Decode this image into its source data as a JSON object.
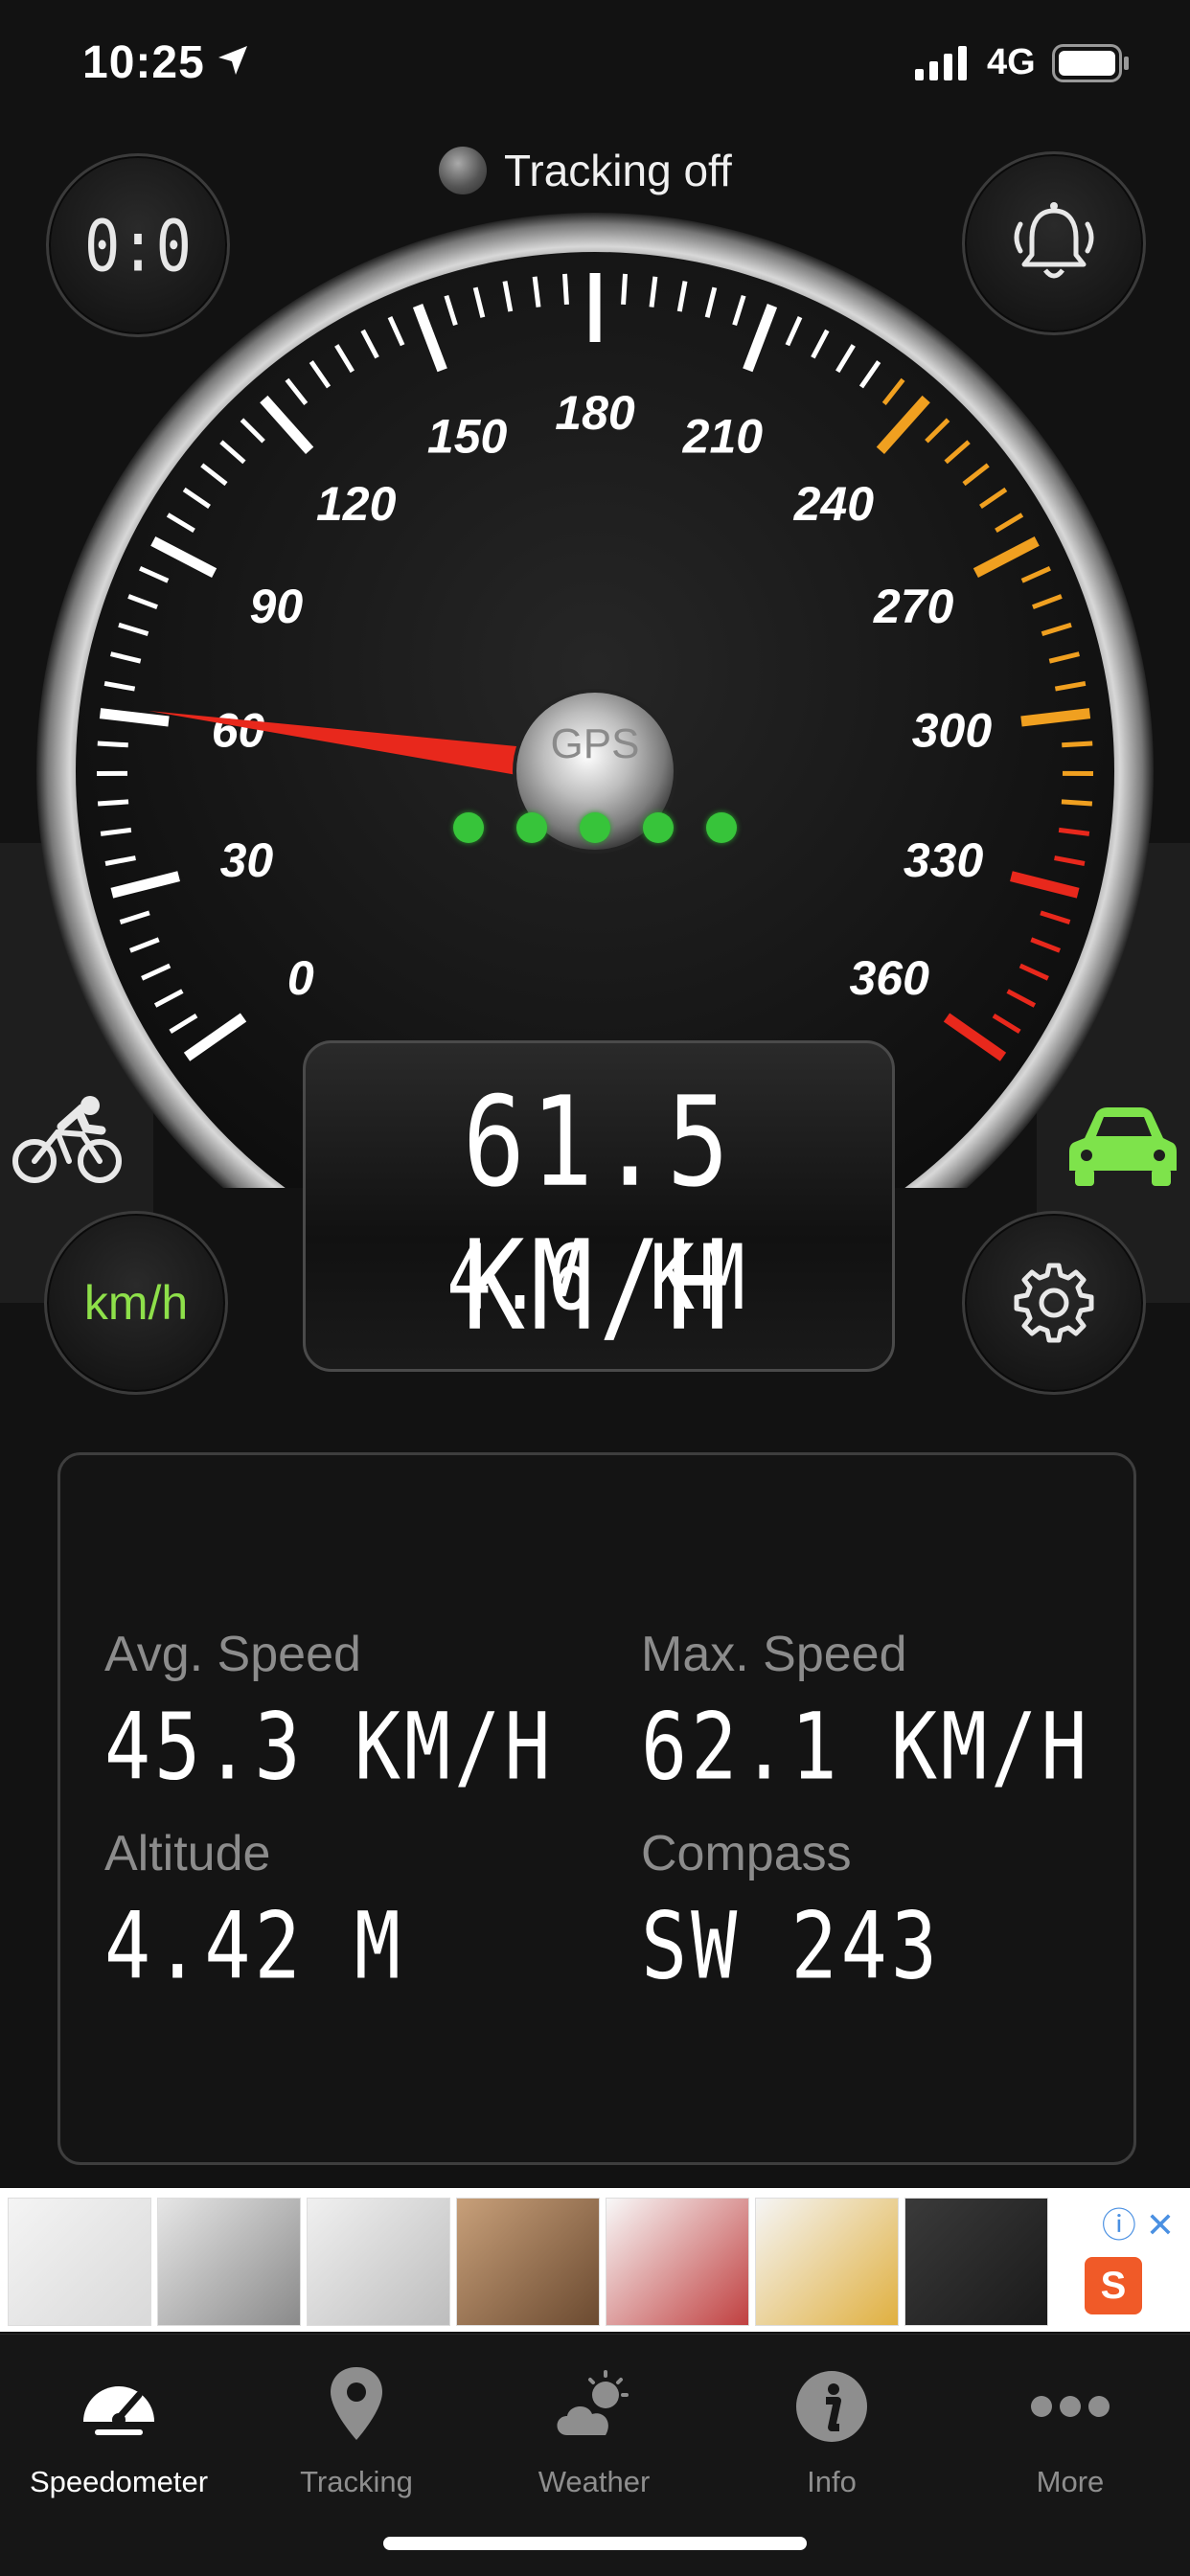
{
  "status_bar": {
    "time": "10:25",
    "network": "4G"
  },
  "tracking": {
    "status_text": "Tracking off"
  },
  "controls": {
    "timer_label": "0:0",
    "unit_label": "km/h"
  },
  "gauge": {
    "gps_label": "GPS",
    "gps_signal_bars": 5,
    "tick_labels": [
      "0",
      "30",
      "60",
      "90",
      "120",
      "150",
      "180",
      "210",
      "240",
      "270",
      "300",
      "330",
      "360"
    ],
    "max_value": 360,
    "needle_value": 61.5,
    "colors": {
      "accent_orange": "#f0a020",
      "accent_red": "#e8281c",
      "gps_green": "#37c43a",
      "active_green": "#7ee34b"
    }
  },
  "readout": {
    "speed": "61.5 KM/H",
    "distance": "4.6 KM"
  },
  "stats": {
    "avg_speed": {
      "label": "Avg. Speed",
      "value": "45.3 KM/H"
    },
    "max_speed": {
      "label": "Max. Speed",
      "value": "62.1 KM/H"
    },
    "altitude": {
      "label": "Altitude",
      "value": "4.42 M"
    },
    "compass": {
      "label": "Compass",
      "value": "SW 243"
    }
  },
  "ad": {
    "shop_glyph": "S",
    "info_glyph": "ⓘ ✕"
  },
  "tabs": [
    {
      "label": "Speedometer",
      "icon": "speedometer-icon",
      "active": true
    },
    {
      "label": "Tracking",
      "icon": "location-pin-icon",
      "active": false
    },
    {
      "label": "Weather",
      "icon": "weather-icon",
      "active": false
    },
    {
      "label": "Info",
      "icon": "info-icon",
      "active": false
    },
    {
      "label": "More",
      "icon": "more-icon",
      "active": false
    }
  ]
}
